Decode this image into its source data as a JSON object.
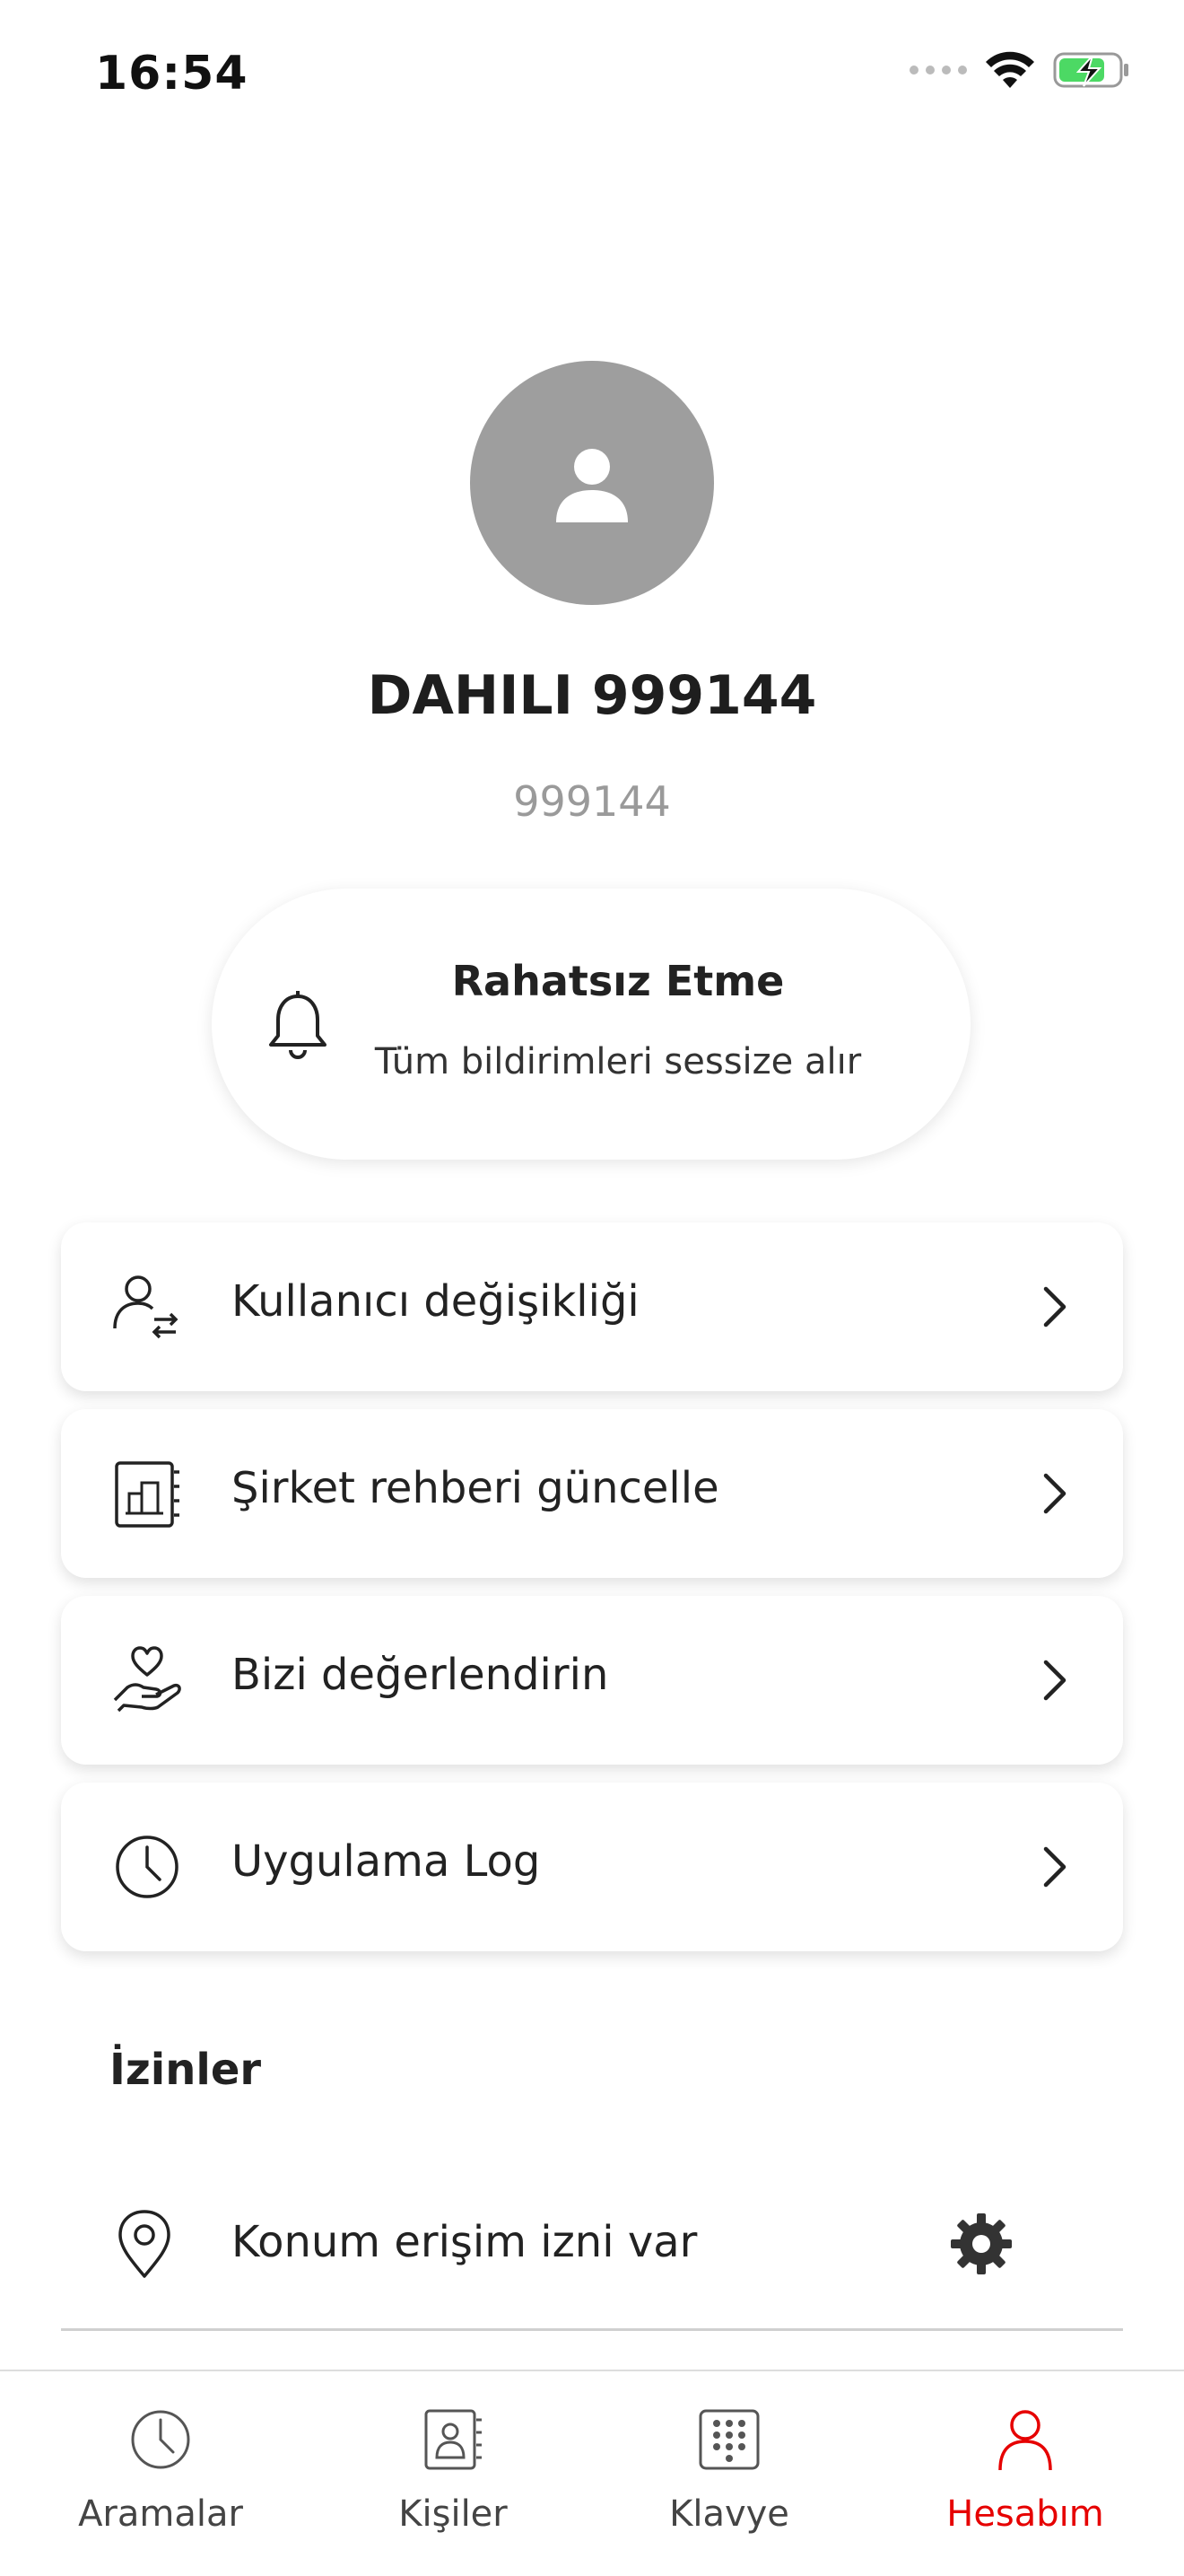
{
  "status_bar": {
    "time": "16:54",
    "icons": [
      "signal-dots-icon",
      "wifi-icon",
      "battery-charging-icon"
    ],
    "battery_color": "#4cd964"
  },
  "profile": {
    "avatar_icon": "person-icon",
    "name": "DAHILI 999144",
    "number": "999144"
  },
  "dnd": {
    "icon": "bell-icon",
    "title": "Rahatsız Etme",
    "subtitle": "Tüm bildirimleri sessize alır"
  },
  "menu": [
    {
      "label": "Kullanıcı değişikliği",
      "icon": "user-switch-icon"
    },
    {
      "label": "Şirket rehberi güncelle",
      "icon": "company-directory-icon"
    },
    {
      "label": "Bizi değerlendirin",
      "icon": "heart-hand-icon"
    },
    {
      "label": "Uygulama Log",
      "icon": "clock-icon"
    }
  ],
  "permissions": {
    "title": "İzinler",
    "items": [
      {
        "label": "Konum erişim izni var",
        "icon": "location-pin-icon",
        "action_icon": "gear-icon"
      }
    ]
  },
  "tabs": [
    {
      "label": "Aramalar",
      "icon": "clock-icon",
      "active": false
    },
    {
      "label": "Kişiler",
      "icon": "contacts-icon",
      "active": false
    },
    {
      "label": "Klavye",
      "icon": "keypad-icon",
      "active": false
    },
    {
      "label": "Hesabım",
      "icon": "account-icon",
      "active": true
    }
  ],
  "colors": {
    "accent": "#e60000",
    "avatar_bg": "#9e9e9e",
    "text": "#222222",
    "muted": "#9a9a9a"
  }
}
